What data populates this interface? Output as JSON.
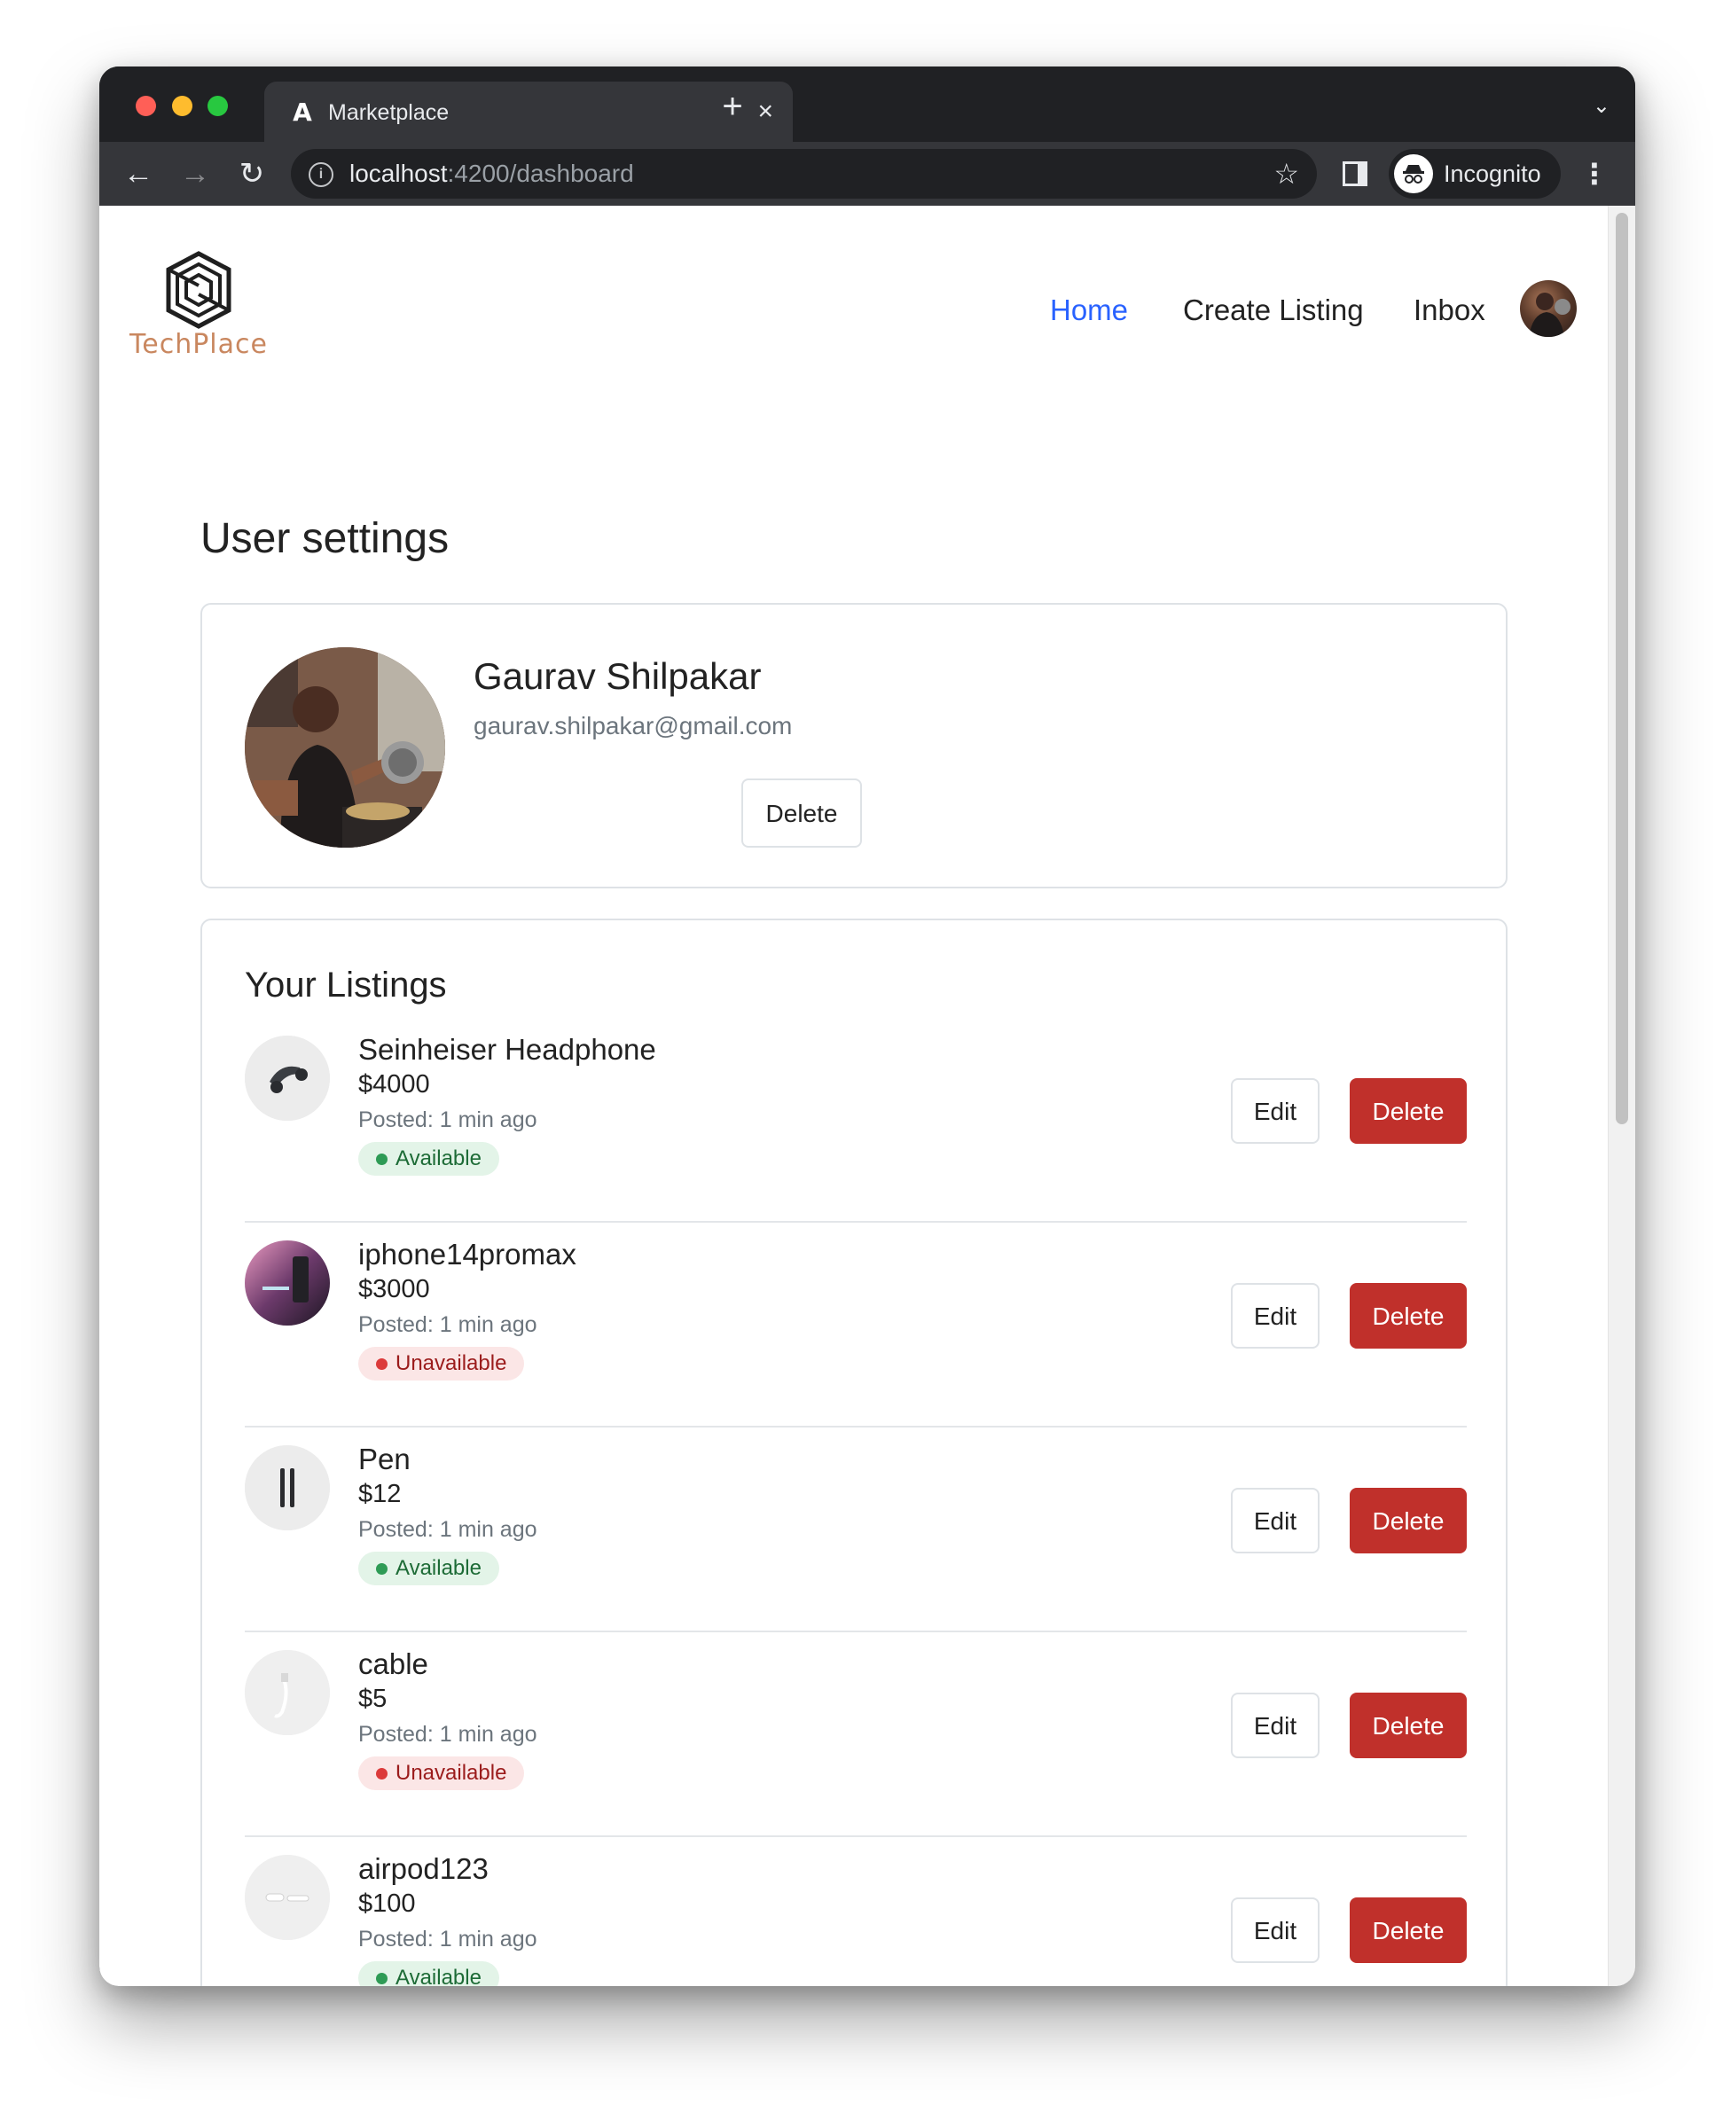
{
  "browser": {
    "tab_title": "Marketplace",
    "tab_close_icon": "×",
    "new_tab_icon": "+",
    "url_host": "localhost",
    "url_path": ":4200/dashboard",
    "profile_label": "Incognito"
  },
  "app": {
    "brand_name": "TechPlace",
    "brand_color": "#c9875f",
    "nav": {
      "home": "Home",
      "create_listing": "Create Listing",
      "inbox": "Inbox"
    },
    "active_nav_color": "#2962ff"
  },
  "page": {
    "title": "User settings"
  },
  "profile": {
    "name": "Gaurav Shilpakar",
    "email": "gaurav.shilpakar@gmail.com",
    "delete_label": "Delete"
  },
  "listings": {
    "title": "Your Listings",
    "edit_label": "Edit",
    "delete_label": "Delete",
    "items": [
      {
        "title": "Seinheiser Headphone",
        "price": "$4000",
        "posted": "Posted: 1 min ago",
        "status": "Available",
        "status_type": "available",
        "thumb": "headphone"
      },
      {
        "title": "iphone14promax",
        "price": "$3000",
        "posted": "Posted: 1 min ago",
        "status": "Unavailable",
        "status_type": "unavailable",
        "thumb": "phone"
      },
      {
        "title": "Pen",
        "price": "$12",
        "posted": "Posted: 1 min ago",
        "status": "Available",
        "status_type": "available",
        "thumb": "pen"
      },
      {
        "title": "cable",
        "price": "$5",
        "posted": "Posted: 1 min ago",
        "status": "Unavailable",
        "status_type": "unavailable",
        "thumb": "cable"
      },
      {
        "title": "airpod123",
        "price": "$100",
        "posted": "Posted: 1 min ago",
        "status": "Available",
        "status_type": "available",
        "thumb": "airpod"
      }
    ]
  },
  "colors": {
    "danger": "#c0302b",
    "available_bg": "#e3f4e8",
    "unavailable_bg": "#fbe6e6"
  }
}
